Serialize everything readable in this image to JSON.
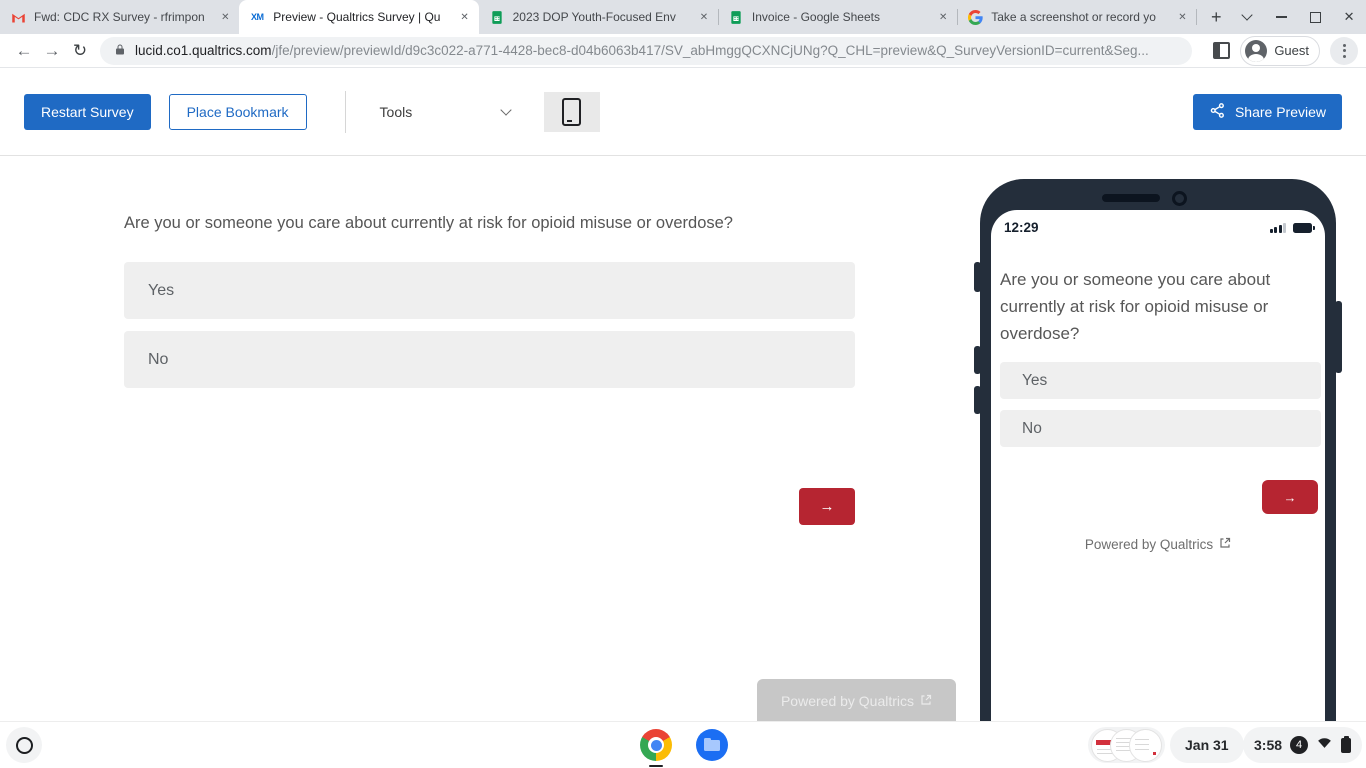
{
  "browser": {
    "tabs": [
      {
        "title": "Fwd: CDC RX Survey - rfrimpon",
        "icon": "gmail-icon"
      },
      {
        "title": "Preview - Qualtrics Survey | Qu",
        "icon": "qualtrics-xm-icon"
      },
      {
        "title": "2023 DOP Youth-Focused Env",
        "icon": "google-sheets-icon"
      },
      {
        "title": "Invoice - Google Sheets",
        "icon": "google-sheets-icon"
      },
      {
        "title": "Take a screenshot or record yo",
        "icon": "google-icon"
      }
    ],
    "xm_glyph": "XM",
    "url_domain": "lucid.co1.qualtrics.com",
    "url_path": "/jfe/preview/previewId/d9c3c022-a771-4428-bec8-d04b6063b417/SV_abHmggQCXNCjUNg?Q_CHL=preview&Q_SurveyVersionID=current&Seg...",
    "profile_label": "Guest"
  },
  "toolbar": {
    "restart_label": "Restart Survey",
    "bookmark_label": "Place Bookmark",
    "tools_label": "Tools",
    "share_label": "Share Preview"
  },
  "survey": {
    "question": "Are you or someone you care about currently at risk for opioid misuse or overdose?",
    "options": [
      "Yes",
      "No"
    ],
    "next_label": "→",
    "powered_by": "Powered by Qualtrics"
  },
  "phone": {
    "status_time": "12:29",
    "question": "Are you or someone you care about currently at risk for opioid misuse or overdose?",
    "options": [
      "Yes",
      "No"
    ],
    "next_label": "→",
    "powered_by": "Powered by Qualtrics"
  },
  "shelf": {
    "date": "Jan 31",
    "time": "3:58",
    "notification_count": "4"
  },
  "colors": {
    "accent_blue": "#1f6ac4",
    "accent_red": "#b62531",
    "option_gray": "#efefef",
    "phone_frame": "#242e3b",
    "tabstrip_gray": "#dee1e6"
  }
}
